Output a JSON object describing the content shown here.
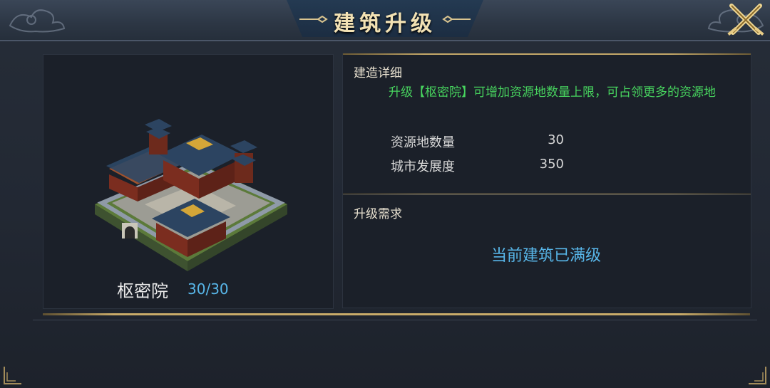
{
  "window": {
    "title": "建筑升级"
  },
  "building": {
    "name": "枢密院",
    "level": "30/30"
  },
  "details": {
    "section_title": "建造详细",
    "description": "升级【枢密院】可增加资源地数量上限，可占领更多的资源地",
    "stats": [
      {
        "label": "资源地数量",
        "value": "30"
      },
      {
        "label": "城市发展度",
        "value": "350"
      }
    ]
  },
  "requirements": {
    "section_title": "升级需求",
    "status": "当前建筑已满级"
  },
  "colors": {
    "accent_gold": "#c9ab69",
    "green_text": "#47d35e",
    "blue_text": "#58b7ea",
    "title_text": "#f3e2b4"
  },
  "icons": {
    "close": "crossed-swords-close-icon",
    "title_ornament": "ornament-icon",
    "corner": "corner-ornament-icon"
  }
}
